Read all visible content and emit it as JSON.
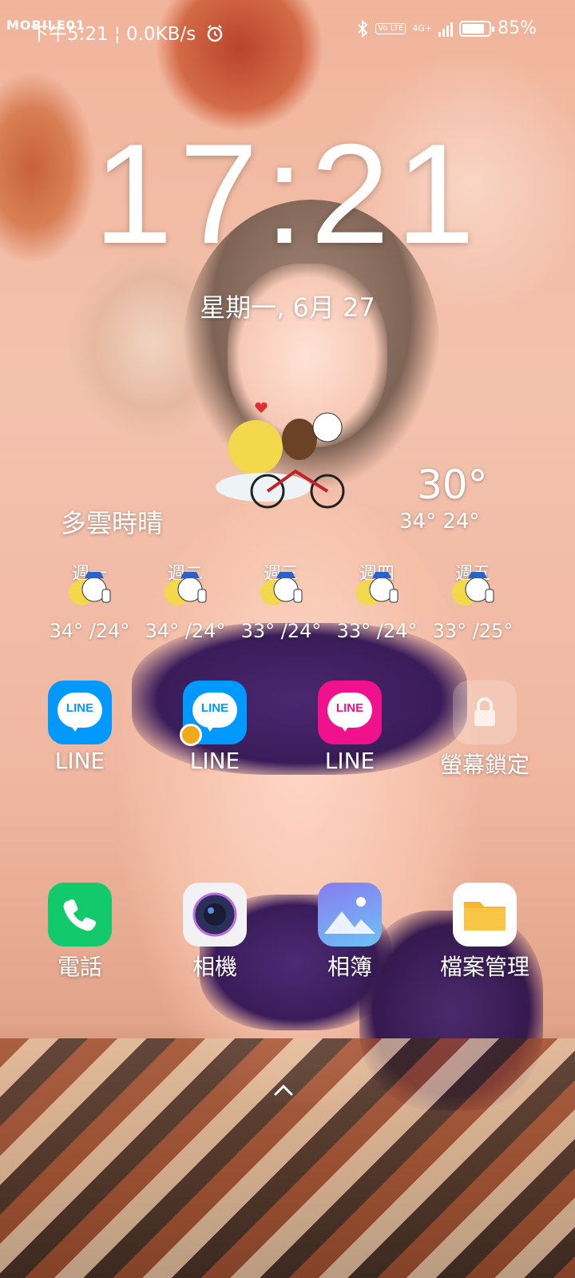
{
  "watermark": "MOBILE01",
  "status_bar": {
    "left_text": "下午5:21 ¦ 0.0KB/s",
    "icons": [
      "alarm-icon",
      "bluetooth-icon",
      "volte-icon",
      "signal-icon",
      "battery-icon"
    ],
    "volte_label": "Vo LTE",
    "network": "4G+",
    "battery_level": 0.85,
    "battery_text": "85%"
  },
  "lockscreen": {
    "time": "17:21",
    "date": "星期一, 6月 27"
  },
  "weather": {
    "condition": "多雲時晴",
    "temp": "30°",
    "range": "34° 24°",
    "forecast": [
      {
        "day": "週一",
        "range": "34° /24°"
      },
      {
        "day": "週二",
        "range": "34° /24°"
      },
      {
        "day": "週三",
        "range": "33° /24°"
      },
      {
        "day": "週四",
        "range": "33° /24°"
      },
      {
        "day": "週五",
        "range": "33° /25°"
      }
    ]
  },
  "apps": {
    "row1": [
      {
        "label": "LINE",
        "icon_text": "LINE",
        "color": "#0099ff"
      },
      {
        "label": "LINE",
        "icon_text": "LINE",
        "color": "#0099ff"
      },
      {
        "label": "LINE",
        "icon_text": "LINE",
        "color": "#f0118c"
      },
      {
        "label": "螢幕鎖定"
      }
    ],
    "row2": [
      {
        "label": "電話",
        "color": "#12c96b"
      },
      {
        "label": "相機"
      },
      {
        "label": "相簿"
      },
      {
        "label": "檔案管理",
        "color": "#f5b72d"
      }
    ]
  }
}
